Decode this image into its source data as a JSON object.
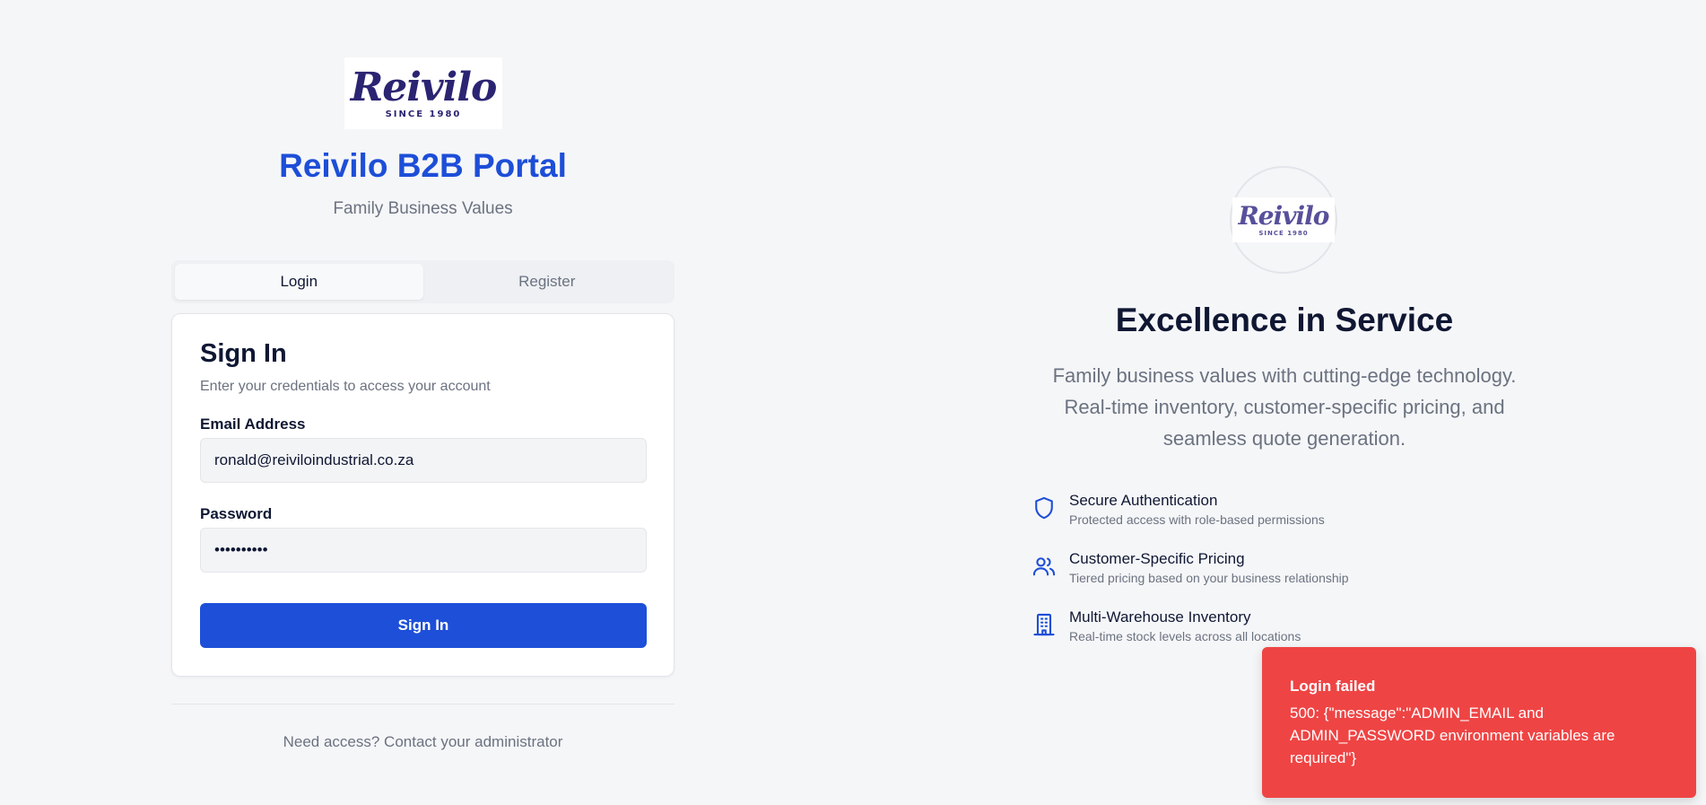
{
  "brand": {
    "logo_word": "Reivilo",
    "logo_since": "SINCE 1980",
    "portal_title": "Reivilo B2B Portal",
    "portal_subtitle": "Family Business Values"
  },
  "tabs": [
    {
      "label": "Login",
      "active": true
    },
    {
      "label": "Register",
      "active": false
    }
  ],
  "signin": {
    "title": "Sign In",
    "description": "Enter your credentials to access your account",
    "email_label": "Email Address",
    "email_value": "ronald@reiviloindustrial.co.za",
    "password_label": "Password",
    "password_value": "••••••••••",
    "submit_label": "Sign In"
  },
  "footer": {
    "text": "Need access? Contact your administrator"
  },
  "hero": {
    "title": "Excellence in Service",
    "description": "Family business values with cutting-edge technology. Real-time inventory, customer-specific pricing, and seamless quote generation."
  },
  "features": [
    {
      "icon": "shield-icon",
      "title": "Secure Authentication",
      "description": "Protected access with role-based permissions"
    },
    {
      "icon": "users-icon",
      "title": "Customer-Specific Pricing",
      "description": "Tiered pricing based on your business relationship"
    },
    {
      "icon": "building-icon",
      "title": "Multi-Warehouse Inventory",
      "description": "Real-time stock levels across all locations"
    }
  ],
  "toast": {
    "title": "Login failed",
    "message": "500: {\"message\":\"ADMIN_EMAIL and ADMIN_PASSWORD environment variables are required\"}"
  },
  "colors": {
    "primary": "#1d4fd8",
    "brand_title": "#1d4ed8",
    "logo_navy": "#2b2472",
    "toast_bg": "#ef4444",
    "background": "#f5f6f8"
  }
}
